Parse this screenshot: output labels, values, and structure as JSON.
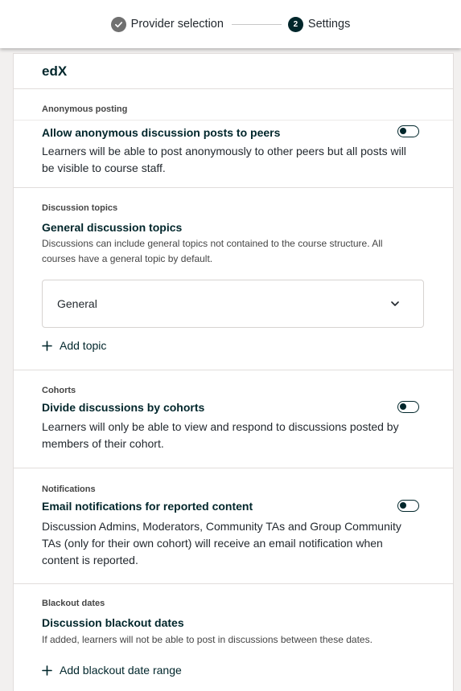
{
  "stepper": {
    "steps": [
      {
        "label": "Provider selection",
        "state": "complete"
      },
      {
        "label": "Settings",
        "number": "2",
        "state": "current"
      }
    ]
  },
  "card": {
    "title": "edX",
    "sections": [
      {
        "label": "Anonymous posting",
        "heading": "Allow anonymous discussion posts to peers",
        "description": "Learners will be able to post anonymously to other peers but all posts will be visible to course staff.",
        "toggle": "off"
      },
      {
        "label": "Discussion topics",
        "heading": "General discussion topics",
        "description": "Discussions can include general topics not contained to the course structure. All courses have a general topic by default.",
        "topics": [
          {
            "name": "General"
          }
        ],
        "add_label": "Add topic"
      },
      {
        "label": "Cohorts",
        "heading": "Divide discussions by cohorts",
        "description": "Learners will only be able to view and respond to discussions posted by members of their cohort.",
        "toggle": "off"
      },
      {
        "label": "Notifications",
        "heading": "Email notifications for reported content",
        "description": "Discussion Admins, Moderators, Community TAs and Group Community TAs (only for their own cohort) will receive an email notification when content is reported.",
        "toggle": "off"
      },
      {
        "label": "Blackout dates",
        "heading": "Discussion blackout dates",
        "description": "If added, learners will not be able to post in discussions between these dates.",
        "add_label": "Add blackout date range"
      }
    ]
  },
  "icons": {
    "complete_step": "check-circle-icon",
    "expand": "chevron-down-icon",
    "add": "plus-icon"
  },
  "colors": {
    "primary": "#00262b",
    "complete_step": "#707070",
    "background": "#f2f0ef"
  }
}
